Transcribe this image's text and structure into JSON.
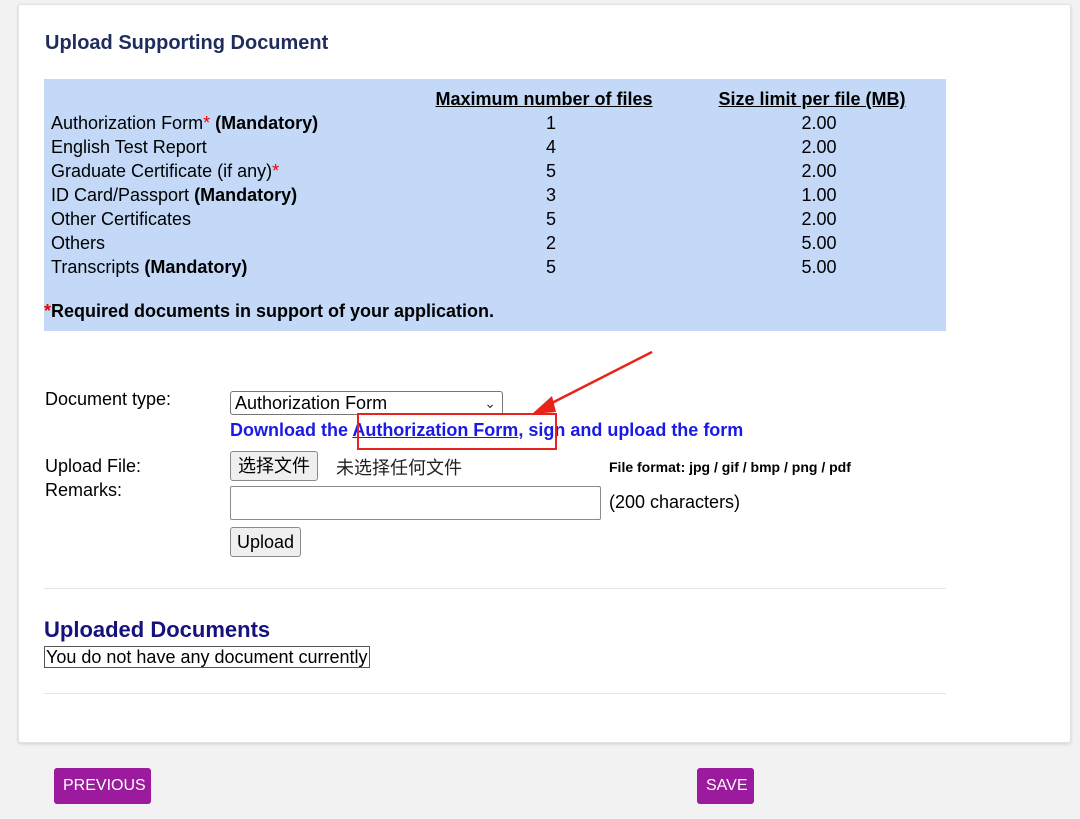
{
  "page": {
    "title": "Upload Supporting Document"
  },
  "requirements": {
    "header_files": "Maximum number of files",
    "header_size": "Size limit per file (MB)",
    "rows": [
      {
        "name": "Authorization Form",
        "required_mark": "*",
        "suffix": "(Mandatory)",
        "max_files": "1",
        "size_limit": "2.00"
      },
      {
        "name": "English Test Report",
        "required_mark": "",
        "suffix": "",
        "max_files": "4",
        "size_limit": "2.00"
      },
      {
        "name": "Graduate Certificate (if any)",
        "required_mark": "*",
        "suffix": "",
        "max_files": "5",
        "size_limit": "2.00"
      },
      {
        "name": "ID Card/Passport",
        "required_mark": "",
        "suffix": "(Mandatory)",
        "max_files": "3",
        "size_limit": "1.00"
      },
      {
        "name": "Other Certificates",
        "required_mark": "",
        "suffix": "",
        "max_files": "5",
        "size_limit": "2.00"
      },
      {
        "name": "Others",
        "required_mark": "",
        "suffix": "",
        "max_files": "2",
        "size_limit": "5.00"
      },
      {
        "name": "Transcripts",
        "required_mark": "",
        "suffix": "(Mandatory)",
        "max_files": "5",
        "size_limit": "5.00"
      }
    ],
    "footnote_mark": "*",
    "footnote": "Required documents in support of your application."
  },
  "form": {
    "doc_type_label": "Document type:",
    "doc_type_value": "Authorization Form",
    "download_prefix": "Download the ",
    "download_link": "Authorization Form",
    "download_suffix": ", sign and upload the form",
    "upload_file_label": "Upload File:",
    "choose_file_button": "选择文件",
    "no_file_text": "未选择任何文件",
    "file_format_note": "File format: jpg / gif / bmp / png / pdf",
    "remarks_label": "Remarks:",
    "remarks_value": "",
    "remarks_limit": "(200 characters)",
    "upload_button": "Upload"
  },
  "uploaded": {
    "title": "Uploaded Documents",
    "empty_message": "You do not have any document currently"
  },
  "nav": {
    "previous": "PREVIOUS",
    "save": "SAVE"
  },
  "colors": {
    "info_box_bg": "#c3d9f7",
    "link_blue": "#1a1ae6",
    "nav_button_purple": "#9b1a9e",
    "annotation_red": "#e8231b"
  },
  "icons": {
    "select_chevron": "chevron-down-icon",
    "annotation_arrow": "arrow-icon"
  }
}
